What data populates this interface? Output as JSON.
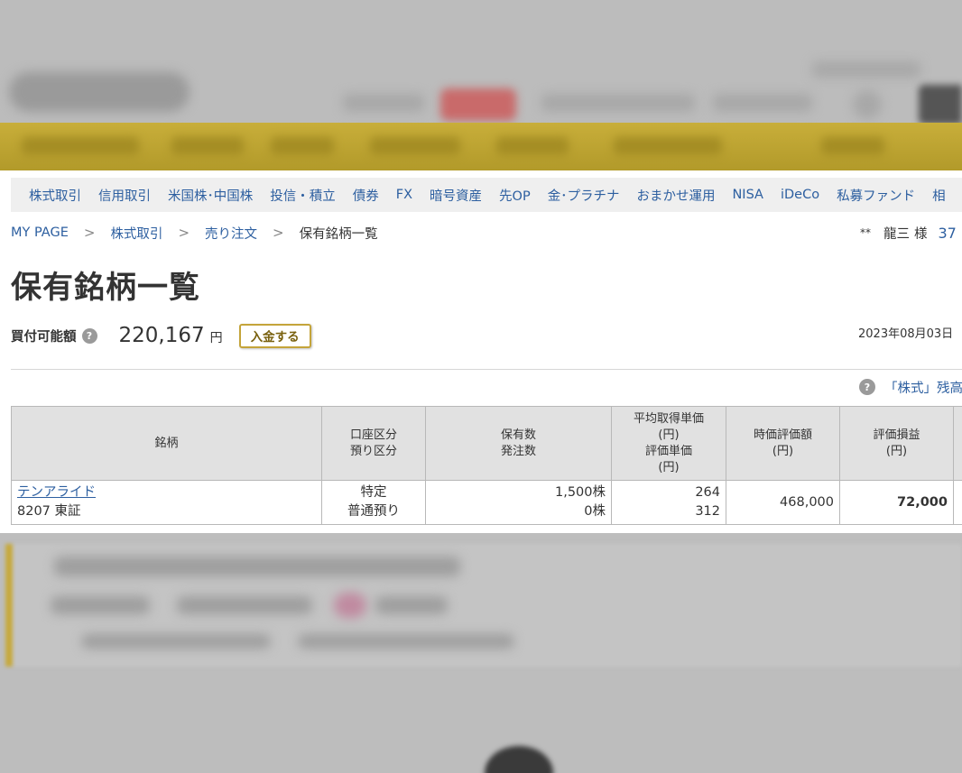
{
  "nav": {
    "items": [
      "株式取引",
      "信用取引",
      "米国株･中国株",
      "投信・積立",
      "債券",
      "FX",
      "暗号資産",
      "先OP",
      "金･プラチナ",
      "おまかせ運用",
      "NISA",
      "iDeCo",
      "私募ファンド",
      "相"
    ]
  },
  "breadcrumb": {
    "items": [
      "MY PAGE",
      "株式取引",
      "売り注文"
    ],
    "current": "保有銘柄一覧",
    "separator": ">"
  },
  "user": {
    "stars": "**",
    "name": "龍三",
    "honorific": "様",
    "number": "37"
  },
  "page_title": "保有銘柄一覧",
  "buying_power": {
    "label": "買付可能額",
    "help_icon": "?",
    "amount": "220,167",
    "unit": "円",
    "deposit_button": "入金する"
  },
  "date": "2023年08月03日",
  "balance_link": {
    "help_icon": "?",
    "text": "「株式」残高"
  },
  "table": {
    "headers": {
      "stock": "銘柄",
      "account_1": "口座区分",
      "account_2": "預り区分",
      "qty_1": "保有数",
      "qty_2": "発注数",
      "avg_1": "平均取得単価",
      "avg_2": "(円)",
      "avg_3": "評価単価",
      "avg_4": "(円)",
      "value_1": "時価評価額",
      "value_2": "(円)",
      "pl_1": "評価損益",
      "pl_2": "(円)"
    },
    "rows": [
      {
        "name": "テンアライド",
        "code_market": "8207 東証",
        "account": "特定",
        "custody": "普通預り",
        "held": "1,500株",
        "ordered": "0株",
        "avg_cost": "264",
        "eval_price": "312",
        "market_value": "468,000",
        "profit_loss": "72,000"
      }
    ]
  },
  "colors": {
    "link": "#2d5fa0",
    "gold_band": "#c8ae3a",
    "button_border": "#c4a43a"
  }
}
